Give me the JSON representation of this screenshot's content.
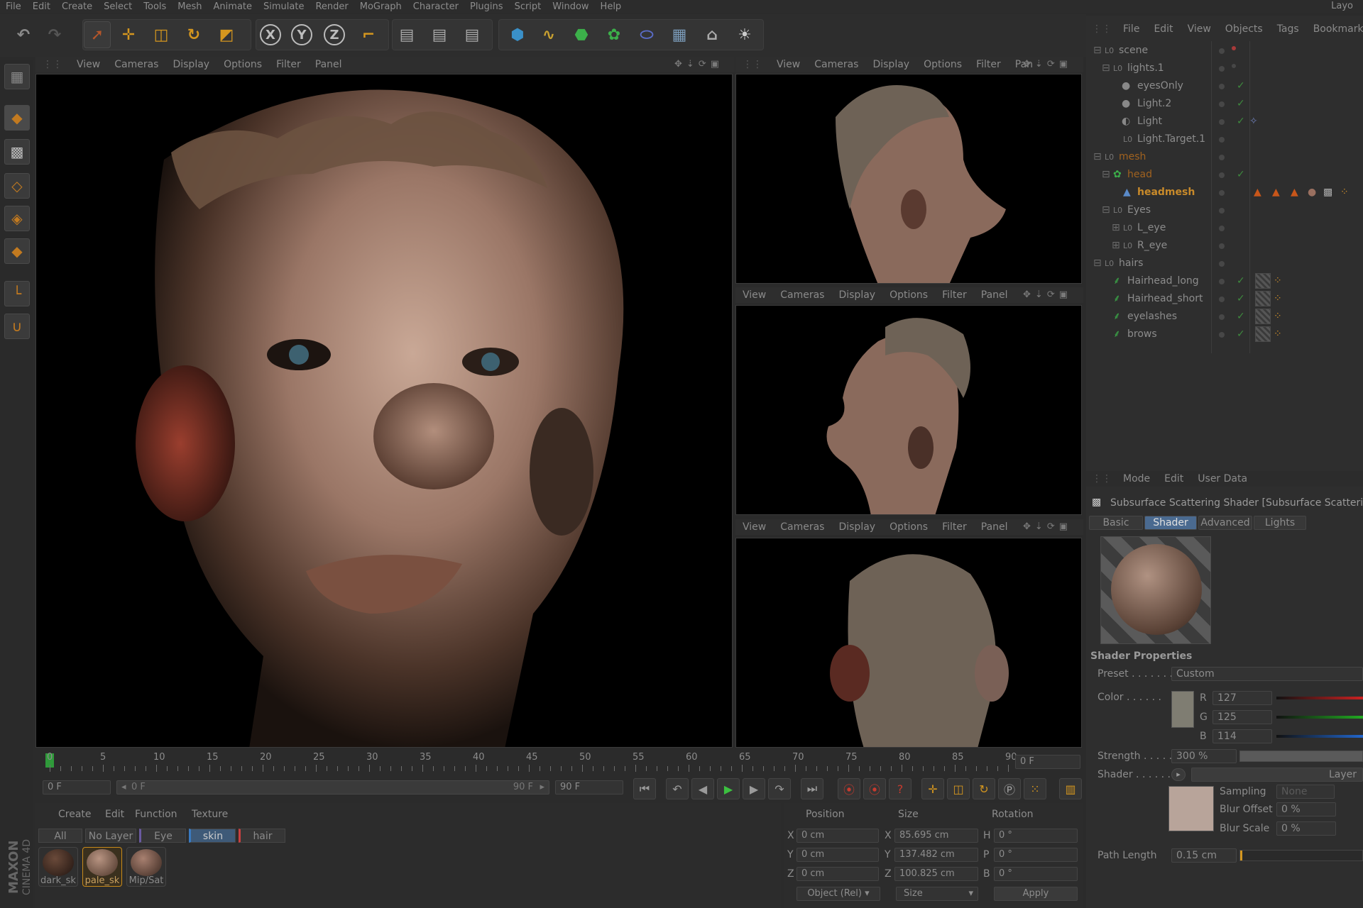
{
  "menu": {
    "items": [
      "File",
      "Edit",
      "Create",
      "Select",
      "Tools",
      "Mesh",
      "Animate",
      "Simulate",
      "Render",
      "MoGraph",
      "Character",
      "Plugins",
      "Script",
      "Window",
      "Help"
    ],
    "layout_label": "Layo"
  },
  "toolbar": {
    "axis_x": "X",
    "axis_y": "Y",
    "axis_z": "Z",
    "icons": [
      "undo-icon",
      "redo-icon",
      "select-arrow-icon",
      "move-icon",
      "scale-icon",
      "rotate-icon",
      "live-select-icon",
      "x-axis-icon",
      "y-axis-icon",
      "z-axis-icon",
      "coordinate-system-icon",
      "render-view-icon",
      "render-picture-viewer-icon",
      "render-settings-icon",
      "cube-icon",
      "spline-icon",
      "nurbs-icon",
      "array-icon",
      "deformer-icon",
      "floor-icon",
      "camera-icon",
      "light-icon"
    ]
  },
  "viewport_menu": [
    "View",
    "Cameras",
    "Display",
    "Options",
    "Filter",
    "Panel"
  ],
  "viewport_menu_truncated_panel": "Pan",
  "timeline": {
    "labels": [
      "0",
      "5",
      "10",
      "15",
      "20",
      "25",
      "30",
      "35",
      "40",
      "45",
      "50",
      "55",
      "60",
      "65",
      "70",
      "75",
      "80",
      "85",
      "90"
    ],
    "current_frame_field": "0 F",
    "start_field": "0 F",
    "range_left": "0 F",
    "range_right": "90 F",
    "end_field": "90 F"
  },
  "material_manager": {
    "menu": [
      "Create",
      "Edit",
      "Function",
      "Texture"
    ],
    "layers": [
      "All",
      "No Layer",
      "Eye",
      "skin",
      "hair"
    ],
    "active_layer": "skin",
    "materials": [
      {
        "name": "dark_sk",
        "color": "#4a3326"
      },
      {
        "name": "pale_sk",
        "color": "#9a7d6b",
        "selected": true
      },
      {
        "name": "Mip/Sat",
        "color": "#8f7363"
      }
    ]
  },
  "coordinates": {
    "headers": {
      "position": "Position",
      "size": "Size",
      "rotation": "Rotation"
    },
    "rows": [
      {
        "axis": "X",
        "pos": "0 cm",
        "size_axis": "X",
        "size": "85.695 cm",
        "rot_axis": "H",
        "rot": "0 °"
      },
      {
        "axis": "Y",
        "pos": "0 cm",
        "size_axis": "Y",
        "size": "137.482 cm",
        "rot_axis": "P",
        "rot": "0 °"
      },
      {
        "axis": "Z",
        "pos": "0 cm",
        "size_axis": "Z",
        "size": "100.825 cm",
        "rot_axis": "B",
        "rot": "0 °"
      }
    ],
    "mode_select": "Object (Rel)",
    "size_select": "Size",
    "apply_label": "Apply"
  },
  "object_manager": {
    "menu": [
      "File",
      "Edit",
      "View",
      "Objects",
      "Tags",
      "Bookmarks"
    ],
    "rows": [
      {
        "name": "scene",
        "indent": 0,
        "color": "#8c8c8c",
        "check": false
      },
      {
        "name": "lights.1",
        "indent": 1,
        "color": "#8c8c8c",
        "check": false
      },
      {
        "name": "eyesOnly",
        "indent": 2,
        "color": "#8c8c8c",
        "check": true
      },
      {
        "name": "Light.2",
        "indent": 2,
        "color": "#8c8c8c",
        "check": true
      },
      {
        "name": "Light",
        "indent": 2,
        "color": "#8c8c8c",
        "check": true
      },
      {
        "name": "Light.Target.1",
        "indent": 2,
        "color": "#8c8c8c",
        "check": false
      },
      {
        "name": "mesh",
        "indent": 0,
        "color": "#a0621f",
        "check": false
      },
      {
        "name": "head",
        "indent": 1,
        "color": "#a0621f",
        "check": true
      },
      {
        "name": "headmesh",
        "indent": 2,
        "color": "#c88a2a",
        "check": false
      },
      {
        "name": "Eyes",
        "indent": 1,
        "color": "#8c8c8c",
        "check": false
      },
      {
        "name": "L_eye",
        "indent": 2,
        "color": "#8c8c8c",
        "check": false
      },
      {
        "name": "R_eye",
        "indent": 2,
        "color": "#8c8c8c",
        "check": false
      },
      {
        "name": "hairs",
        "indent": 0,
        "color": "#8c8c8c",
        "check": false
      },
      {
        "name": "Hairhead_long",
        "indent": 1,
        "color": "#8c8c8c",
        "check": true
      },
      {
        "name": "Hairhead_short",
        "indent": 1,
        "color": "#8c8c8c",
        "check": true
      },
      {
        "name": "eyelashes",
        "indent": 1,
        "color": "#8c8c8c",
        "check": true
      },
      {
        "name": "brows",
        "indent": 1,
        "color": "#8c8c8c",
        "check": true
      }
    ]
  },
  "attributes": {
    "menu": [
      "Mode",
      "Edit",
      "User Data"
    ],
    "title": "Subsurface Scattering Shader [Subsurface Scattering",
    "tabs": [
      "Basic",
      "Shader",
      "Advanced",
      "Lights"
    ],
    "active_tab": "Shader",
    "section": "Shader Properties",
    "preset_label": "Preset . . . . . . .",
    "preset_value": "Custom",
    "color_label": "Color . . . . . .",
    "r_label": "R",
    "r_value": "127",
    "g_label": "G",
    "g_value": "125",
    "b_label": "B",
    "b_value": "114",
    "swatch_color": "#7f7d72",
    "strength_label": "Strength . . . . .",
    "strength_value": "300 %",
    "shader_label": "Shader . . . . . .",
    "shader_value": "Layer",
    "sampling_label": "Sampling",
    "sampling_value": "None",
    "blur_offset_label": "Blur Offset",
    "blur_offset_value": "0 %",
    "blur_scale_label": "Blur Scale",
    "blur_scale_value": "0 %",
    "path_length_label": "Path Length",
    "path_length_value": "0.15 cm"
  },
  "branding": {
    "line1": "MAXON",
    "line2": "CINEMA 4D"
  }
}
